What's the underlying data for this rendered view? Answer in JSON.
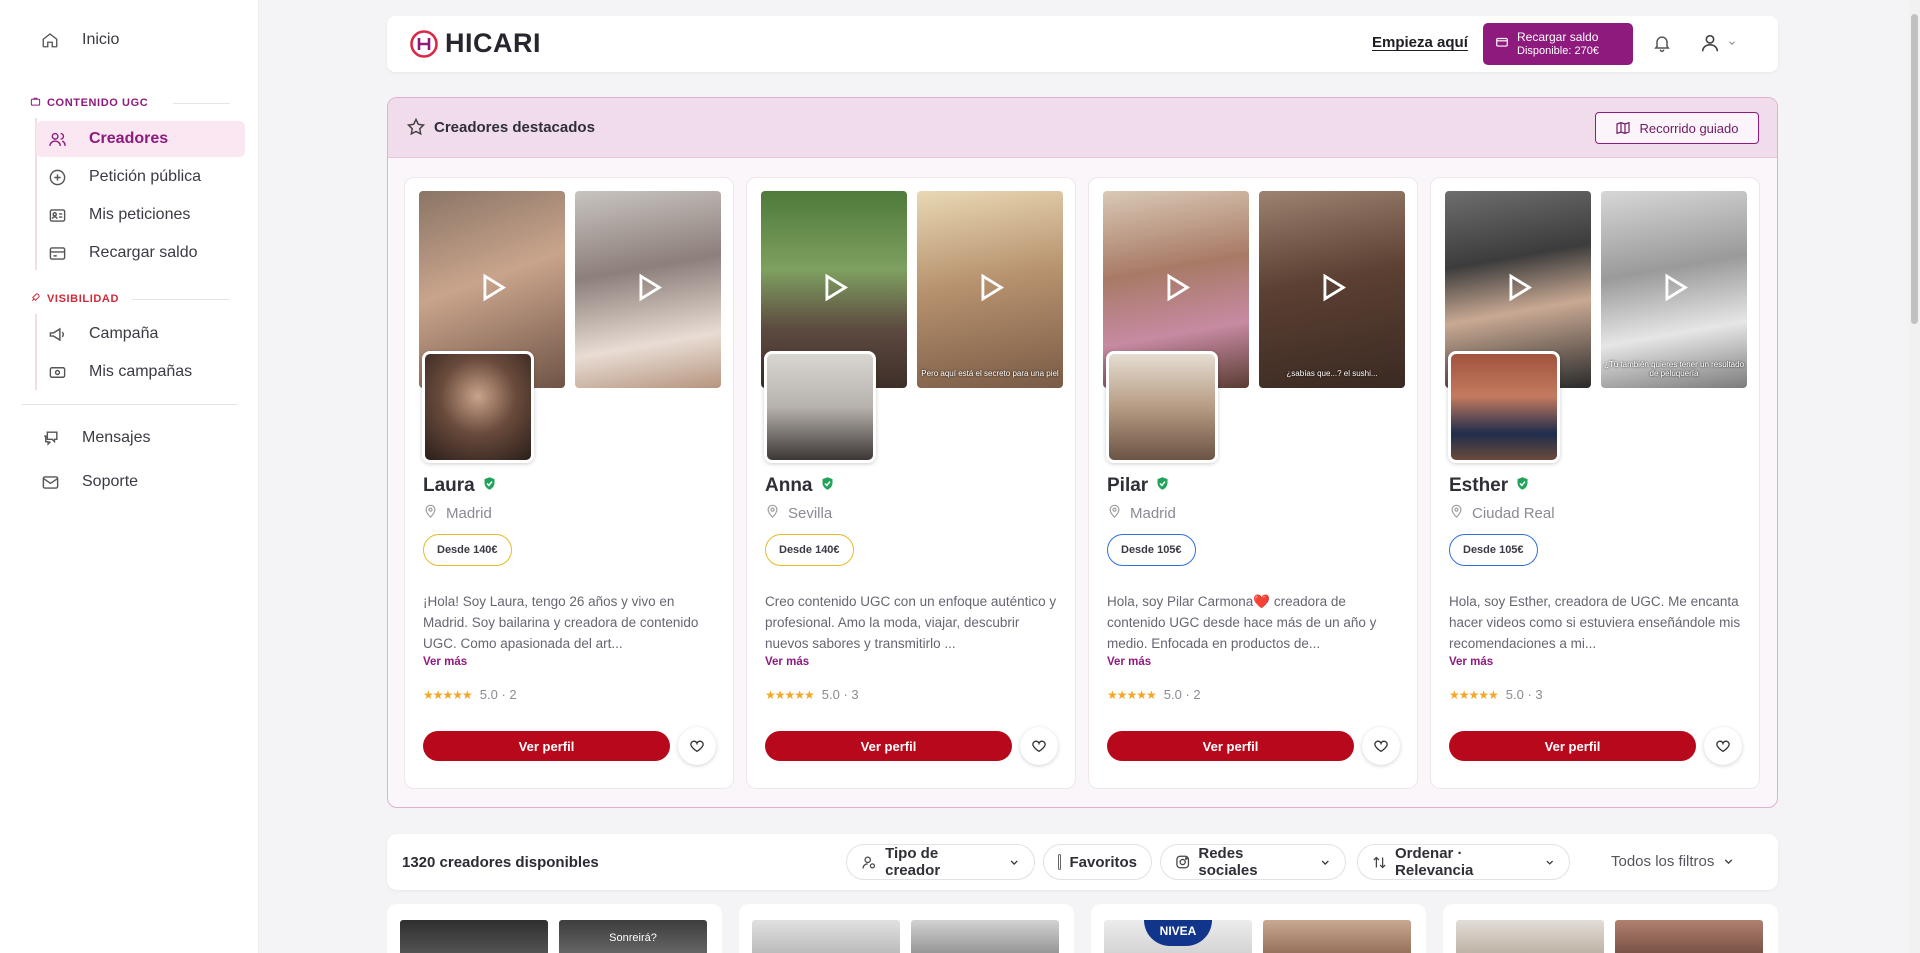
{
  "sidebar": {
    "inicio": "Inicio",
    "section_ugc": "CONTENIDO UGC",
    "ugc_items": [
      "Creadores",
      "Petición pública",
      "Mis peticiones",
      "Recargar saldo"
    ],
    "section_vis": "VISIBILIDAD",
    "vis_items": [
      "Campaña",
      "Mis campañas"
    ],
    "mensajes": "Mensajes",
    "soporte": "Soporte"
  },
  "topbar": {
    "logo": "HICARI",
    "start_link": "Empieza aquí",
    "recharge_label": "Recargar saldo",
    "balance": "Disponible: 270€"
  },
  "featured": {
    "title": "Creadores destacados",
    "guide_btn": "Recorrido guiado",
    "cards": [
      {
        "name": "Laura",
        "city": "Madrid",
        "price": "Desde 140€",
        "bio": "¡Hola! Soy Laura, tengo 26 años y vivo en Madrid. Soy bailarina y creadora de contenido UGC. Como apasionada del art...",
        "more": "Ver más",
        "stars": "★★★★★",
        "rating": "5.0 · 2",
        "button": "Ver perfil",
        "thumb_captions": [
          "",
          ""
        ]
      },
      {
        "name": "Anna",
        "city": "Sevilla",
        "price": "Desde 140€",
        "bio": "Creo contenido UGC con un enfoque auténtico y profesional. Amo la moda, viajar, descubrir nuevos sabores y transmitirlo ...",
        "more": "Ver más",
        "stars": "★★★★★",
        "rating": "5.0 · 3",
        "button": "Ver perfil",
        "thumb_captions": [
          "",
          "Pero aquí está el secreto para una piel"
        ]
      },
      {
        "name": "Pilar",
        "city": "Madrid",
        "price": "Desde 105€",
        "bio": "Hola, soy Pilar Carmona❤️ creadora de contenido UGC desde hace más de un año y medio. Enfocada en productos de...",
        "more": "Ver más",
        "stars": "★★★★★",
        "rating": "5.0 · 2",
        "button": "Ver perfil",
        "thumb_captions": [
          "",
          "¿sabías que...? el sushi..."
        ]
      },
      {
        "name": "Esther",
        "city": "Ciudad Real",
        "price": "Desde 105€",
        "bio": "Hola, soy Esther, creadora de UGC. Me encanta hacer videos como si estuviera enseñándole mis recomendaciones a mi...",
        "more": "Ver más",
        "stars": "★★★★★",
        "rating": "5.0 · 3",
        "button": "Ver perfil",
        "thumb_captions": [
          "",
          "¿Tú también quieres tener un resultado de peluquería"
        ]
      }
    ]
  },
  "filters": {
    "count": "1320 creadores disponibles",
    "type": "Tipo de creador",
    "favorites": "Favoritos",
    "social": "Redes sociales",
    "order": "Ordenar · Relevancia",
    "all": "Todos los filtros"
  },
  "bottom": {
    "caption": "Sonreirá?",
    "brand": "NIVEA"
  },
  "colors": {
    "brand_purple": "#8e1a7e",
    "primary_red": "#b8091c",
    "verified_green": "#22a35a",
    "price_gold": "#e8b92a",
    "price_blue": "#2f6fdc"
  }
}
